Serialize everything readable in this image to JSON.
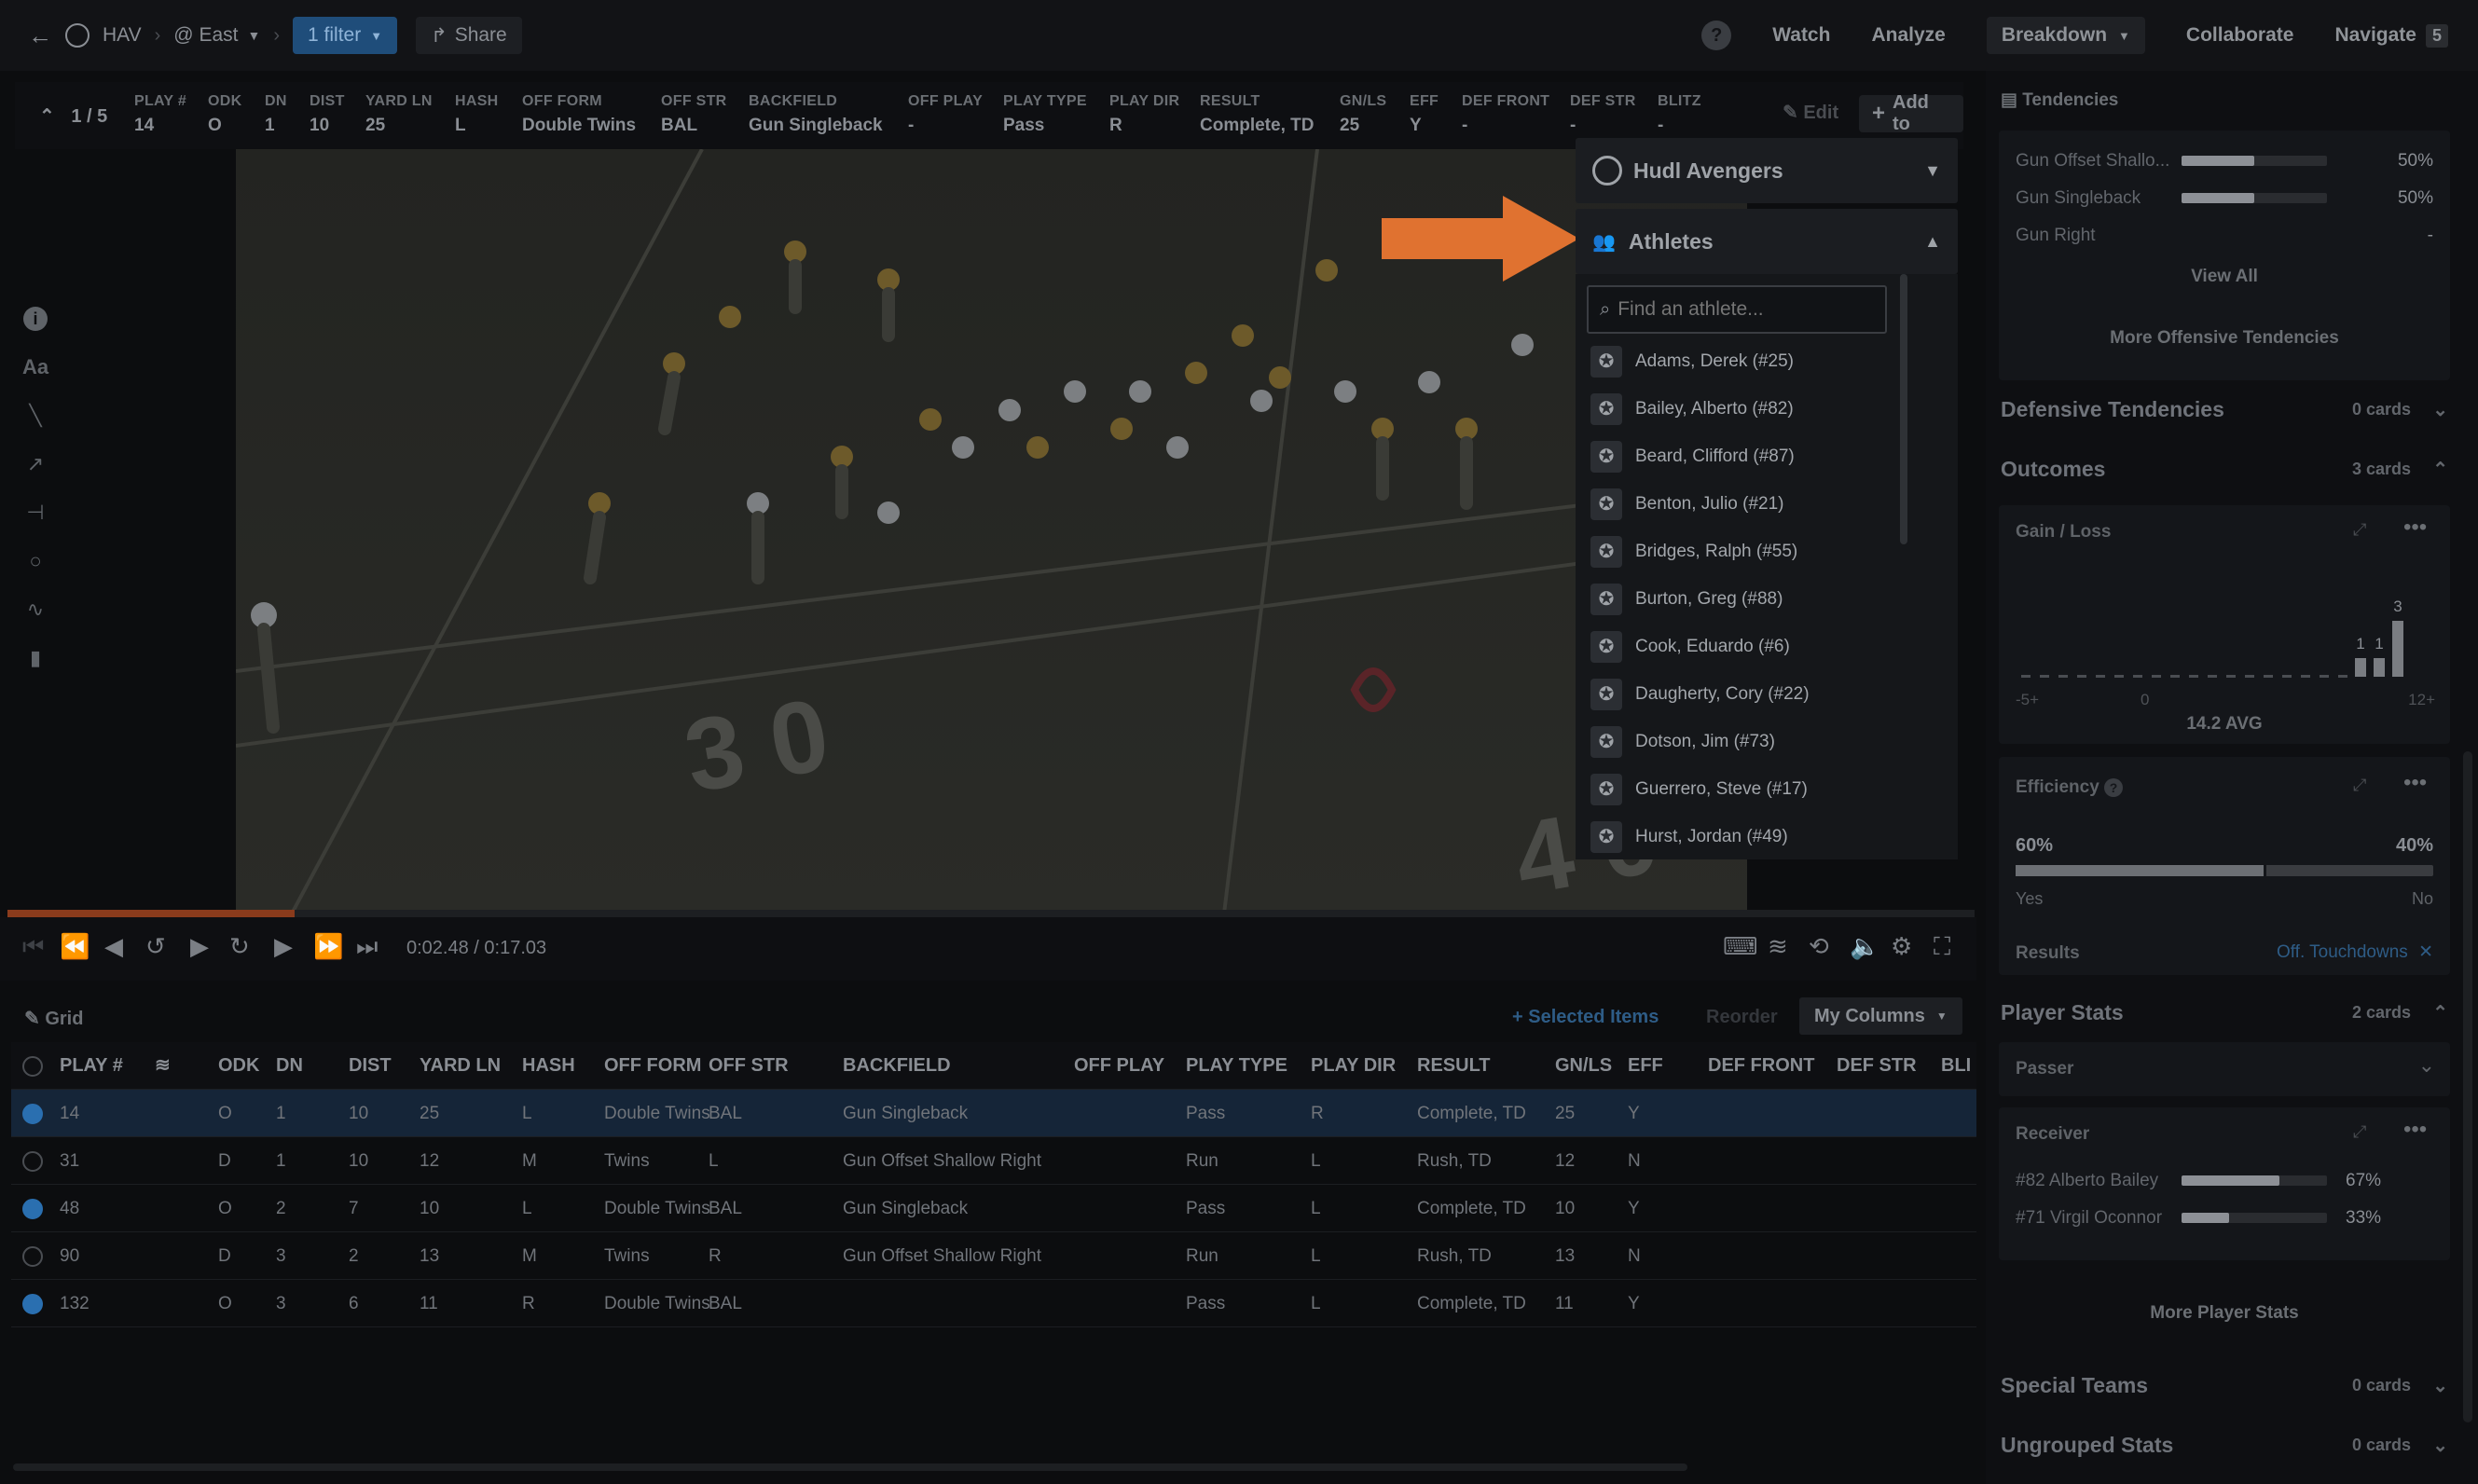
{
  "topbar": {
    "back_label": "HAV",
    "team_label": "@ East",
    "filter_label": "1 filter",
    "share_label": "Share",
    "help": "?",
    "nav": [
      "Watch",
      "Analyze",
      "Breakdown",
      "Collaborate",
      "Navigate"
    ],
    "navigate_badge": "5"
  },
  "playstrip": {
    "counter": "1 / 5",
    "columns": [
      {
        "h": "PLAY #",
        "v": "14"
      },
      {
        "h": "ODK",
        "v": "O"
      },
      {
        "h": "DN",
        "v": "1"
      },
      {
        "h": "DIST",
        "v": "10"
      },
      {
        "h": "YARD LN",
        "v": "25"
      },
      {
        "h": "HASH",
        "v": "L"
      },
      {
        "h": "OFF FORM",
        "v": "Double Twins"
      },
      {
        "h": "OFF STR",
        "v": "BAL"
      },
      {
        "h": "BACKFIELD",
        "v": "Gun Singleback"
      },
      {
        "h": "OFF PLAY",
        "v": "-"
      },
      {
        "h": "PLAY TYPE",
        "v": "Pass"
      },
      {
        "h": "PLAY DIR",
        "v": "R"
      },
      {
        "h": "RESULT",
        "v": "Complete, TD"
      },
      {
        "h": "GN/LS",
        "v": "25"
      },
      {
        "h": "EFF",
        "v": "Y"
      },
      {
        "h": "DEF FRONT",
        "v": "-"
      },
      {
        "h": "DEF STR",
        "v": "-"
      },
      {
        "h": "BLITZ",
        "v": "-"
      }
    ],
    "edit_label": "Edit",
    "add_label": "Add to"
  },
  "athletes_panel": {
    "team": "Hudl Avengers",
    "section": "Athletes",
    "search_placeholder": "Find an athlete...",
    "athletes": [
      "Adams, Derek (#25)",
      "Bailey, Alberto (#82)",
      "Beard, Clifford (#87)",
      "Benton, Julio (#21)",
      "Bridges, Ralph (#55)",
      "Burton, Greg (#88)",
      "Cook, Eduardo (#6)",
      "Daugherty, Cory (#22)",
      "Dotson, Jim (#73)",
      "Guerrero, Steve (#17)",
      "Hurst, Jordan (#49)"
    ]
  },
  "controls": {
    "time": "0:02.48 / 0:17.03",
    "progress": 0.146
  },
  "gridbar": {
    "title": "Grid",
    "selected_label": "Selected Items",
    "reorder_label": "Reorder",
    "columns_label": "My Columns"
  },
  "grid": {
    "headers": [
      "PLAY #",
      "",
      "ODK",
      "DN",
      "DIST",
      "YARD LN",
      "HASH",
      "OFF FORM",
      "OFF STR",
      "BACKFIELD",
      "OFF PLAY",
      "PLAY TYPE",
      "PLAY DIR",
      "RESULT",
      "GN/LS",
      "EFF",
      "DEF FRONT",
      "DEF STR",
      "BLI"
    ],
    "rows": [
      {
        "checked": true,
        "cells": [
          "14",
          "",
          "O",
          "1",
          "10",
          "25",
          "L",
          "Double Twins",
          "BAL",
          "Gun Singleback",
          "",
          "Pass",
          "R",
          "Complete, TD",
          "25",
          "Y",
          "",
          "",
          ""
        ]
      },
      {
        "checked": false,
        "cells": [
          "31",
          "",
          "D",
          "1",
          "10",
          "12",
          "M",
          "Twins",
          "L",
          "Gun Offset Shallow Right",
          "",
          "Run",
          "L",
          "Rush, TD",
          "12",
          "N",
          "",
          "",
          ""
        ]
      },
      {
        "checked": true,
        "cells": [
          "48",
          "",
          "O",
          "2",
          "7",
          "10",
          "L",
          "Double Twins",
          "BAL",
          "Gun Singleback",
          "",
          "Pass",
          "L",
          "Complete, TD",
          "10",
          "Y",
          "",
          "",
          ""
        ]
      },
      {
        "checked": false,
        "cells": [
          "90",
          "",
          "D",
          "3",
          "2",
          "13",
          "M",
          "Twins",
          "R",
          "Gun Offset Shallow Right",
          "",
          "Run",
          "L",
          "Rush, TD",
          "13",
          "N",
          "",
          "",
          ""
        ]
      },
      {
        "checked": true,
        "cells": [
          "132",
          "",
          "O",
          "3",
          "6",
          "11",
          "R",
          "Double Twins",
          "BAL",
          "",
          "",
          "Pass",
          "L",
          "Complete, TD",
          "11",
          "Y",
          "",
          "",
          ""
        ]
      }
    ]
  },
  "right_panel": {
    "tendencies_title": "Tendencies",
    "tendencies": [
      {
        "label": "Gun Offset Shallo...",
        "pct": "50%",
        "value": 0.5
      },
      {
        "label": "Gun Singleback",
        "pct": "50%",
        "value": 0.5
      },
      {
        "label": "Gun Right",
        "pct": "-",
        "value": 0
      }
    ],
    "view_all": "View All",
    "more_offensive": "More Offensive Tendencies",
    "defensive": {
      "title": "Defensive Tendencies",
      "count": "0 cards"
    },
    "outcomes": {
      "title": "Outcomes",
      "count": "3 cards"
    },
    "gain_loss": {
      "title": "Gain / Loss",
      "axis": [
        "-5+",
        "0",
        "12+"
      ],
      "avg": "14.2 AVG",
      "bar_labels": [
        "1",
        "1",
        "3"
      ]
    },
    "efficiency": {
      "title": "Efficiency",
      "yes_pct": "60%",
      "no_pct": "40%",
      "yes_value": 0.6,
      "yes": "Yes",
      "no": "No"
    },
    "results": {
      "title": "Results",
      "filter": "Off. Touchdowns"
    },
    "player_stats": {
      "title": "Player Stats",
      "count": "2 cards"
    },
    "passer": "Passer",
    "receiver": {
      "title": "Receiver",
      "items": [
        {
          "name": "#82 Alberto Bailey",
          "pct": "67%",
          "value": 0.67
        },
        {
          "name": "#71 Virgil Oconnor",
          "pct": "33%",
          "value": 0.33
        }
      ]
    },
    "more_player_stats": "More Player Stats",
    "special_teams": {
      "title": "Special Teams",
      "count": "0 cards"
    },
    "ungrouped": {
      "title": "Ungrouped Stats",
      "count": "0 cards"
    }
  },
  "colors": {
    "accent_orange": "#e07230",
    "selected_blue": "#2a6fb0",
    "filter_blue": "#1f4d7a"
  }
}
